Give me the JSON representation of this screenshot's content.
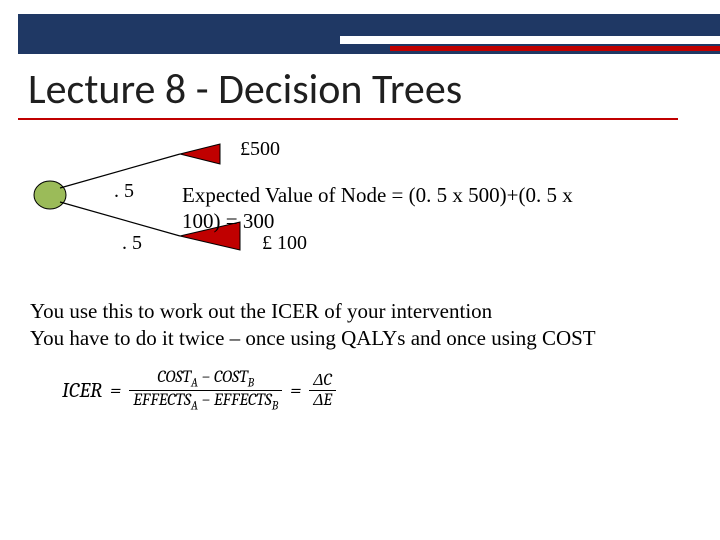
{
  "title": "Lecture 8 - Decision Trees",
  "tree": {
    "top_value": "£500",
    "prob_top": ". 5",
    "prob_bottom": ". 5",
    "bottom_value": "£ 100",
    "ev_text": "Expected Value of Node = (0. 5 x 500)+(0. 5 x 100) = 300"
  },
  "body": {
    "line1": "You use this to work out the ICER of your intervention",
    "line2": "You have to do it twice – once using QALYs and once using COST"
  },
  "formula": {
    "lhs": "ICER",
    "eq": "=",
    "num1_a": "COST",
    "num1_asub": "A",
    "minus": " − ",
    "num1_b": "COST",
    "num1_bsub": "B",
    "den1_a": "EFFECTS",
    "den1_asub": "A",
    "den1_b": "EFFECTS",
    "den1_bsub": "B",
    "dC": "ΔC",
    "dE": "ΔE"
  }
}
